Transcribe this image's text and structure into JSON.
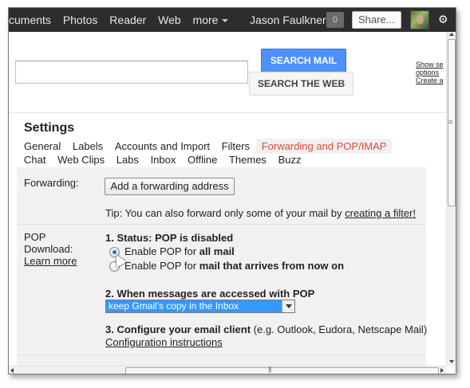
{
  "topbar": {
    "nav": [
      "cuments",
      "Photos",
      "Reader",
      "Web",
      "more"
    ],
    "user_name": "Jason Faulkner",
    "notification_count": "0",
    "share_label": "Share...",
    "gear_glyph": "⚙"
  },
  "search": {
    "search_mail_label": "SEARCH MAIL",
    "search_web_label": "SEARCH THE WEB",
    "side_links": [
      "Show se",
      "options",
      "Create a"
    ]
  },
  "settings": {
    "title": "Settings",
    "tabs_row1": [
      "General",
      "Labels",
      "Accounts and Import",
      "Filters",
      "Forwarding and POP/IMAP"
    ],
    "tabs_row2": [
      "Chat",
      "Web Clips",
      "Labs",
      "Inbox",
      "Offline",
      "Themes",
      "Buzz"
    ],
    "active_tab": "Forwarding and POP/IMAP"
  },
  "forwarding": {
    "label": "Forwarding:",
    "button": "Add a forwarding address",
    "tip_prefix": "Tip: You can also forward only some of your mail by ",
    "tip_link": "creating a filter!"
  },
  "pop": {
    "label_line1": "POP",
    "label_line2": "Download:",
    "learn_more": "Learn more",
    "status": "1. Status: POP is disabled",
    "option_all_prefix": "Enable POP for ",
    "option_all_bold": "all mail",
    "option_now_prefix": "Enable POP for ",
    "option_now_bold": "mail that arrives from now on",
    "when_accessed": "2. When messages are accessed with POP",
    "selected_action": "keep Gmail's copy in the Inbox",
    "configure_bold": "3. Configure your email client",
    "configure_rest": " (e.g. Outlook, Eudora, Netscape Mail)",
    "config_link": "Configuration instructions"
  },
  "colors": {
    "accent_blue": "#4d90fe",
    "active_tab_red": "#dd4b39",
    "topbar_bg": "#2d2d2d"
  }
}
